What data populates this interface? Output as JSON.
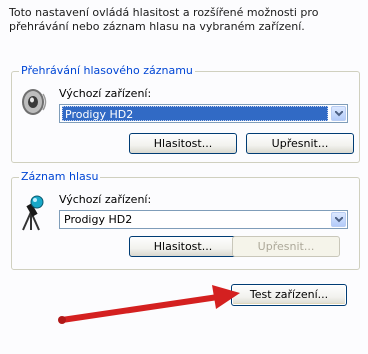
{
  "intro_text": "Toto nastavení ovládá hlasitost a rozšířené možnosti pro přehrávání nebo záznam hlasu na vybraném zařízení.",
  "playback": {
    "legend": "Přehrávání hlasového záznamu",
    "device_label": "Výchozí zařízení:",
    "device_value": "Prodigy HD2",
    "volume_button": "Hlasitost...",
    "advanced_button": "Upřesnit...",
    "icon": "speaker-icon"
  },
  "recording": {
    "legend": "Záznam hlasu",
    "device_label": "Výchozí zařízení:",
    "device_value": "Prodigy HD2",
    "volume_button": "Hlasitost...",
    "advanced_button": "Upřesnit...",
    "icon": "microphone-icon"
  },
  "test_button": "Test zařízení...",
  "colors": {
    "legend": "#0046d5",
    "selection": "#316ac5",
    "annotation_arrow": "#d42020"
  }
}
